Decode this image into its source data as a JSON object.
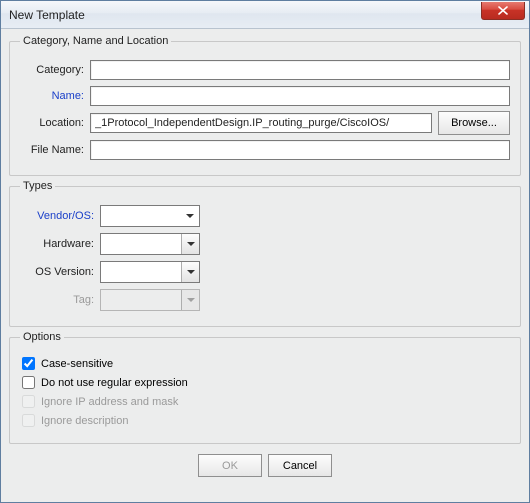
{
  "window": {
    "title": "New Template"
  },
  "category_group": {
    "legend": "Category, Name and Location",
    "category": {
      "label": "Category:",
      "value": ""
    },
    "name": {
      "label": "Name:",
      "value": ""
    },
    "location": {
      "label": "Location:",
      "value": "_1Protocol_IndependentDesign.IP_routing_purge/CiscoIOS/",
      "browse": "Browse..."
    },
    "filename": {
      "label": "File Name:",
      "value": ""
    }
  },
  "types_group": {
    "legend": "Types",
    "vendor": {
      "label": "Vendor/OS:",
      "value": ""
    },
    "hardware": {
      "label": "Hardware:",
      "value": ""
    },
    "osver": {
      "label": "OS Version:",
      "value": ""
    },
    "tag": {
      "label": "Tag:",
      "value": ""
    }
  },
  "options_group": {
    "legend": "Options",
    "case_sensitive": {
      "label": "Case-sensitive",
      "checked": true,
      "enabled": true
    },
    "no_regex": {
      "label": "Do not use regular expression",
      "checked": false,
      "enabled": true
    },
    "ignore_ip": {
      "label": "Ignore IP address and mask",
      "checked": false,
      "enabled": false
    },
    "ignore_desc": {
      "label": "Ignore description",
      "checked": false,
      "enabled": false
    }
  },
  "buttons": {
    "ok": "OK",
    "cancel": "Cancel"
  }
}
